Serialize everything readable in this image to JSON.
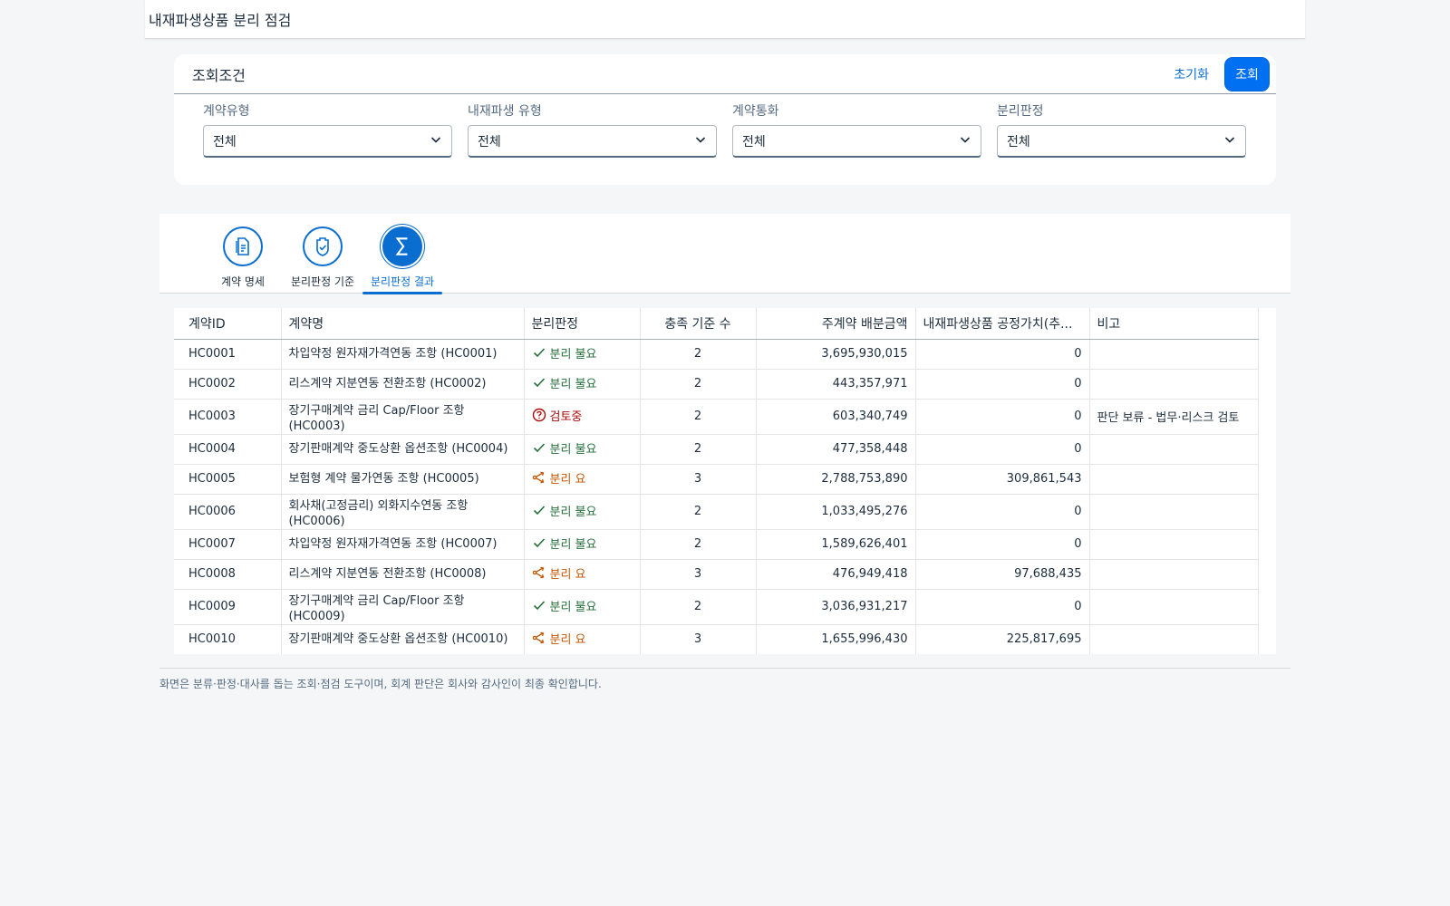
{
  "header": {
    "title": "내재파생상품 분리 점검"
  },
  "filter_bar": {
    "title": "조회조건",
    "reset_label": "초기화",
    "go_label": "조회",
    "fields": [
      {
        "label": "계약유형",
        "value": "전체"
      },
      {
        "label": "내재파생 유형",
        "value": "전체"
      },
      {
        "label": "계약통화",
        "value": "전체"
      },
      {
        "label": "분리판정",
        "value": "전체"
      }
    ]
  },
  "tabs": [
    {
      "label": "계약 명세",
      "icon": "document-icon",
      "active": false
    },
    {
      "label": "분리판정 기준",
      "icon": "shield-check-icon",
      "active": false
    },
    {
      "label": "분리판정 결과",
      "icon": "sigma-icon",
      "active": true
    }
  ],
  "table": {
    "columns": [
      "계약ID",
      "계약명",
      "분리판정",
      "충족 기준 수",
      "주계약 배분금액",
      "내재파생상품 공정가치(추...",
      "비고"
    ],
    "rows": [
      {
        "id": "HC0001",
        "name": "차입약정 원자재가격연동 조항 (HC0001)",
        "status": "분리 불요",
        "status_type": "ok",
        "count": "2",
        "amount": "3,695,930,015",
        "fair_value": "0",
        "note": ""
      },
      {
        "id": "HC0002",
        "name": "리스계약 지분연동 전환조항 (HC0002)",
        "status": "분리 불요",
        "status_type": "ok",
        "count": "2",
        "amount": "443,357,971",
        "fair_value": "0",
        "note": ""
      },
      {
        "id": "HC0003",
        "name": "장기구매계약 금리 Cap/Floor 조항 (HC0003)",
        "status": "검토중",
        "status_type": "warn",
        "count": "2",
        "amount": "603,340,749",
        "fair_value": "0",
        "note": "판단 보류 - 법무·리스크 검토"
      },
      {
        "id": "HC0004",
        "name": "장기판매계약 중도상환 옵션조항 (HC0004)",
        "status": "분리 불요",
        "status_type": "ok",
        "count": "2",
        "amount": "477,358,448",
        "fair_value": "0",
        "note": ""
      },
      {
        "id": "HC0005",
        "name": "보험형 계약 물가연동 조항 (HC0005)",
        "status": "분리 요",
        "status_type": "sep",
        "count": "3",
        "amount": "2,788,753,890",
        "fair_value": "309,861,543",
        "note": ""
      },
      {
        "id": "HC0006",
        "name": "회사채(고정금리) 외화지수연동 조항 (HC0006)",
        "status": "분리 불요",
        "status_type": "ok",
        "count": "2",
        "amount": "1,033,495,276",
        "fair_value": "0",
        "note": ""
      },
      {
        "id": "HC0007",
        "name": "차입약정 원자재가격연동 조항 (HC0007)",
        "status": "분리 불요",
        "status_type": "ok",
        "count": "2",
        "amount": "1,589,626,401",
        "fair_value": "0",
        "note": ""
      },
      {
        "id": "HC0008",
        "name": "리스계약 지분연동 전환조항 (HC0008)",
        "status": "분리 요",
        "status_type": "sep",
        "count": "3",
        "amount": "476,949,418",
        "fair_value": "97,688,435",
        "note": ""
      },
      {
        "id": "HC0009",
        "name": "장기구매계약 금리 Cap/Floor 조항 (HC0009)",
        "status": "분리 불요",
        "status_type": "ok",
        "count": "2",
        "amount": "3,036,931,217",
        "fair_value": "0",
        "note": ""
      },
      {
        "id": "HC0010",
        "name": "장기판매계약 중도상환 옵션조항 (HC0010)",
        "status": "분리 요",
        "status_type": "sep",
        "count": "3",
        "amount": "1,655,996,430",
        "fair_value": "225,817,695",
        "note": ""
      }
    ]
  },
  "footnote": "화면은 분류·판정·대사를 돕는 조회·점검 도구이며, 회계 판단은 회사와 감사인이 최종 확인합니다.",
  "colors": {
    "accent": "#0a6ed1",
    "ok": "#256f3a",
    "warn": "#aa0808",
    "sep": "#c35500"
  }
}
